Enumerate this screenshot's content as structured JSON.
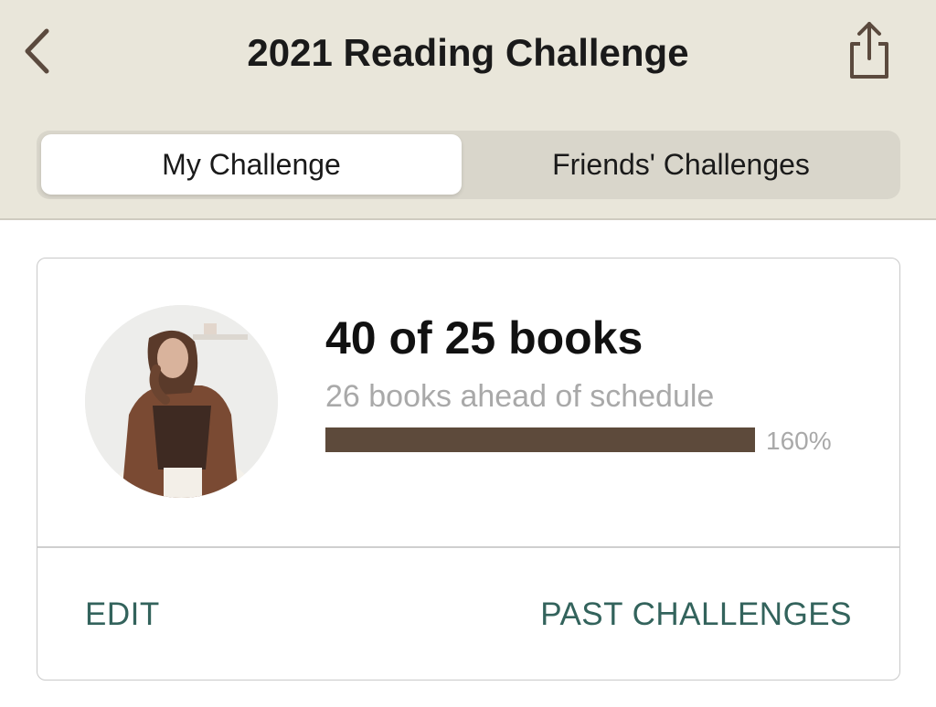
{
  "header": {
    "title": "2021 Reading Challenge",
    "back_icon": "chevron-left-icon",
    "share_icon": "share-icon"
  },
  "tabs": [
    {
      "label": "My Challenge",
      "active": true
    },
    {
      "label": "Friends' Challenges",
      "active": false
    }
  ],
  "challenge": {
    "count_text": "40 of 25 books",
    "schedule_text": "26 books ahead of schedule",
    "progress_percent_text": "160%",
    "progress_fraction": 1.0,
    "edit_label": "EDIT",
    "past_label": "PAST CHALLENGES"
  },
  "colors": {
    "header_bg": "#e9e6da",
    "progress_fill": "#5d4a3b",
    "action_text": "#33635c"
  }
}
